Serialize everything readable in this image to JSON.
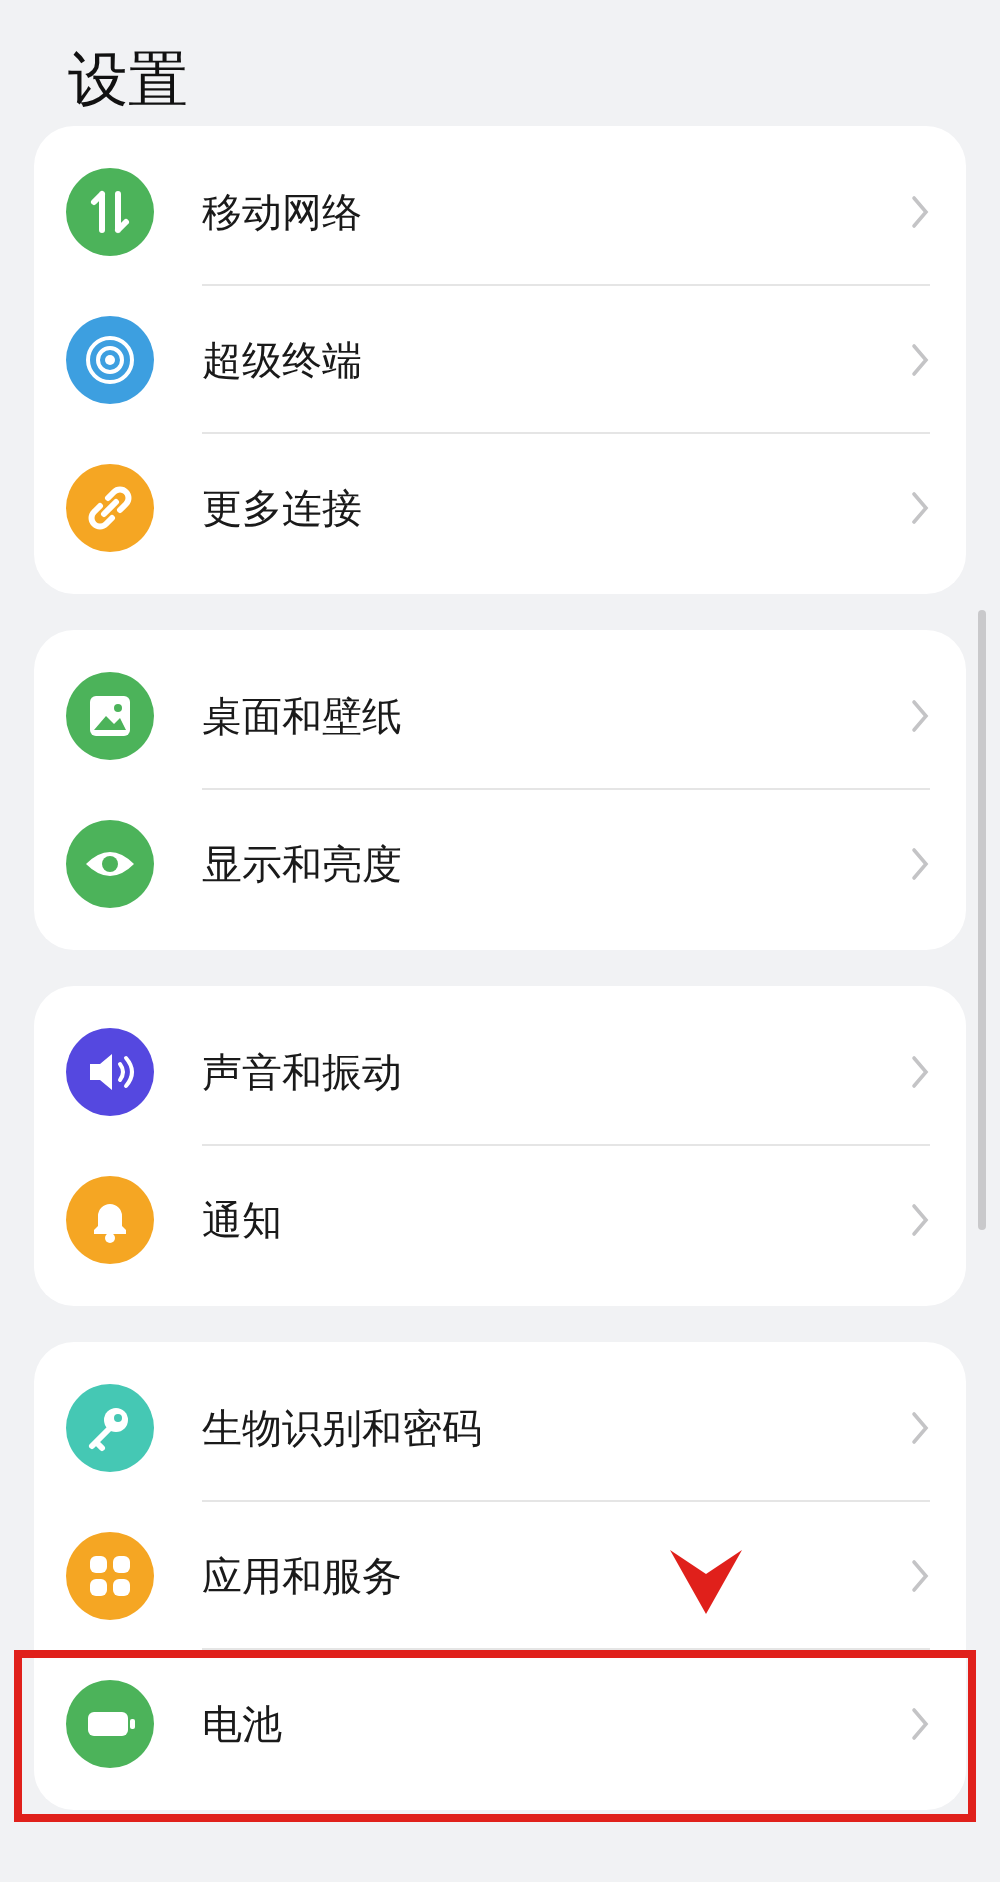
{
  "title": "设置",
  "groups": [
    {
      "items": [
        {
          "label": "移动网络",
          "color": "#4cb35a",
          "highlighted": false
        },
        {
          "label": "超级终端",
          "color": "#3d9fe0",
          "highlighted": false
        },
        {
          "label": "更多连接",
          "color": "#f5a623",
          "highlighted": false
        }
      ]
    },
    {
      "items": [
        {
          "label": "桌面和壁纸",
          "color": "#4cb35a",
          "highlighted": false
        },
        {
          "label": "显示和亮度",
          "color": "#4cb35a",
          "highlighted": false
        }
      ]
    },
    {
      "items": [
        {
          "label": "声音和振动",
          "color": "#5548e0",
          "highlighted": false
        },
        {
          "label": "通知",
          "color": "#f5a623",
          "highlighted": false
        }
      ]
    },
    {
      "items": [
        {
          "label": "生物识别和密码",
          "color": "#45c8b4",
          "highlighted": false
        },
        {
          "label": "应用和服务",
          "color": "#f5a623",
          "highlighted": false
        },
        {
          "label": "电池",
          "color": "#4cb35a",
          "highlighted": true
        }
      ]
    }
  ]
}
